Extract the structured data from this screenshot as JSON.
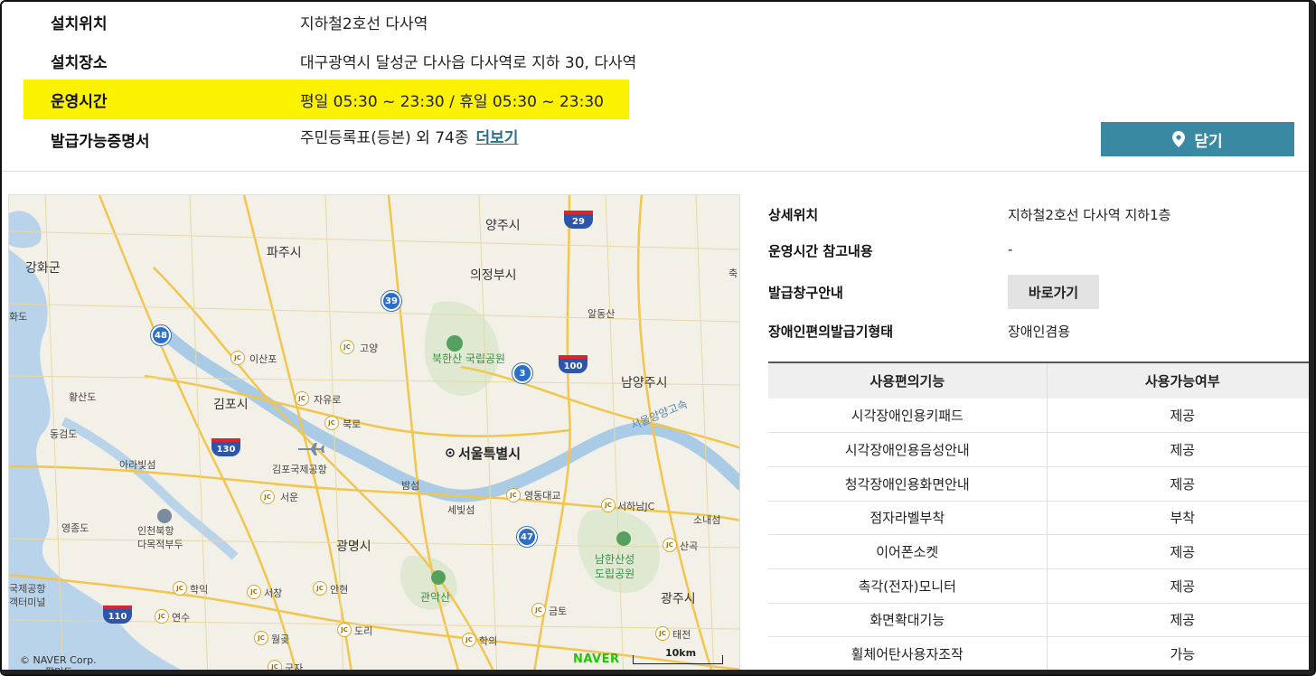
{
  "info": {
    "rows": [
      {
        "label": "설치위치",
        "value": "지하철2호선 다사역"
      },
      {
        "label": "설치장소",
        "value": "대구광역시 달성군 다사읍 다사역로 지하 30, 다사역"
      },
      {
        "label": "운영시간",
        "value": "평일 05:30 ~ 23:30 / 휴일 05:30 ~ 23:30"
      },
      {
        "label": "발급가능증명서",
        "value": "주민등록표(등본) 외 74종"
      }
    ],
    "more_link": "더보기"
  },
  "close_button": {
    "label": "닫기",
    "icon": "map-pin-icon"
  },
  "map": {
    "copyright": "© NAVER Corp.",
    "brand": "NAVER",
    "scale": "10km",
    "labels": {
      "yangju": "양주시",
      "paju": "파주시",
      "ganghwa": "강화군",
      "uijeongbu": "의정부시",
      "hwado": "화도",
      "bukhansan": "북한산\n국립공원",
      "isanpo": "이산포",
      "goyang": "고양",
      "namyangju": "남양주시",
      "hwangsando": "황산도",
      "gimpo": "김포시",
      "jayuro": "자유로",
      "dondong": "동검도",
      "bungno": "북로",
      "seoul": "서울특별시",
      "arabit": "아라빛섬",
      "gimpo_airport": "김포국제공항",
      "seoul_ic": "서운",
      "bamseom": "밤섬",
      "yeongdong": "영동대교",
      "seohaha": "서하남JC",
      "sonaeseom": "소내섬",
      "yeongjongdo": "영종도",
      "incheon_bridge": "인천북항\n다목적부두",
      "saebit": "세빛섬",
      "gwangmyeong": "광명시",
      "sangok": "산곡",
      "namhansan": "남한산성\n도립공원",
      "incheon_airport": "국제공항\n객터미널",
      "hakik": "학익",
      "seochang": "서창",
      "anhyeon": "안현",
      "gwanaksan": "관악산",
      "geumto": "금토",
      "gwangju": "광주시",
      "yeonsu": "연수",
      "dori": "도리",
      "taejeon": "태전",
      "wolgot": "월곶",
      "hagui": "학의",
      "gunja": "군자",
      "palmido": "팔미도",
      "gajingdong": "알동산",
      "expressway": "서울양양고속",
      "chuk": "축"
    },
    "routes": {
      "r29": "29",
      "r39": "39",
      "r48": "48",
      "r3": "3",
      "r100": "100",
      "r130": "130",
      "r47": "47",
      "r110": "110"
    },
    "jc": "JC"
  },
  "details": {
    "rows": [
      {
        "label": "상세위치",
        "value": "지하철2호선 다사역 지하1층"
      },
      {
        "label": "운영시간 참고내용",
        "value": "-"
      },
      {
        "label": "발급창구안내",
        "button": "바로가기"
      },
      {
        "label": "장애인편의발급기형태",
        "value": "장애인겸용"
      }
    ]
  },
  "features": {
    "headers": [
      "사용편의기능",
      "사용가능여부"
    ],
    "rows": [
      [
        "시각장애인용키패드",
        "제공"
      ],
      [
        "시각장애인용음성안내",
        "제공"
      ],
      [
        "청각장애인용화면안내",
        "제공"
      ],
      [
        "점자라벨부착",
        "부착"
      ],
      [
        "이어폰소켓",
        "제공"
      ],
      [
        "촉각(전자)모니터",
        "제공"
      ],
      [
        "화면확대기능",
        "제공"
      ],
      [
        "휠체어탄사용자조작",
        "가능"
      ]
    ]
  }
}
